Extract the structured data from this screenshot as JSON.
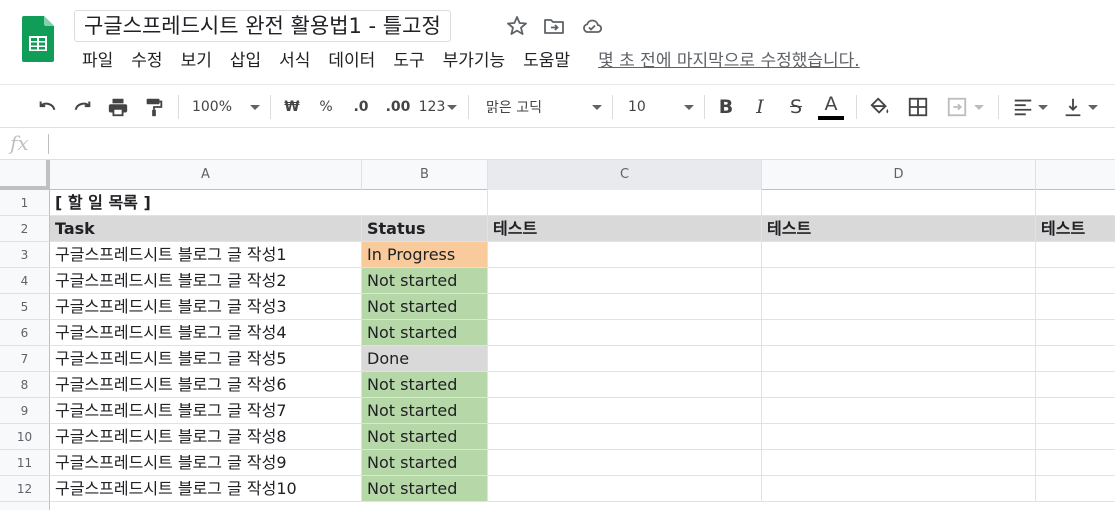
{
  "doc": {
    "title": "구글스프레드시트 완전 활용법1 - 틀고정"
  },
  "colors": {
    "sheets_green": "#0F9D58",
    "in_progress": "#f9cb9c",
    "not_started": "#b6d7a8",
    "done": "#d9d9d9",
    "header_fill": "#d9d9d9"
  },
  "menu": {
    "items": [
      "파일",
      "수정",
      "보기",
      "삽입",
      "서식",
      "데이터",
      "도구",
      "부가기능",
      "도움말"
    ],
    "last_edit": "몇 초 전에 마지막으로 수정했습니다."
  },
  "toolbar": {
    "zoom": "100%",
    "currency": "₩",
    "percent": "%",
    "dec_decrease": ".0",
    "dec_increase": ".00",
    "format_more": "123",
    "font": "맑은 고딕",
    "font_size": "10",
    "bold": "B",
    "italic": "I",
    "strike": "S",
    "text_color": "A"
  },
  "formula": {
    "fx": "fx",
    "value": ""
  },
  "columns": [
    "A",
    "B",
    "C",
    "D"
  ],
  "rows": [
    "1",
    "2",
    "3",
    "4",
    "5",
    "6",
    "7",
    "8",
    "9",
    "10",
    "11",
    "12"
  ],
  "sheet": {
    "r1": {
      "a": "[ 할 일 목록 ]"
    },
    "r2": {
      "a": "Task",
      "b": "Status",
      "c": "테스트",
      "d": "테스트",
      "e": "테스트"
    },
    "tasks": [
      {
        "task": "구글스프레드시트 블로그 글 작성1",
        "status": "In Progress"
      },
      {
        "task": "구글스프레드시트 블로그 글 작성2",
        "status": "Not started"
      },
      {
        "task": "구글스프레드시트 블로그 글 작성3",
        "status": "Not started"
      },
      {
        "task": "구글스프레드시트 블로그 글 작성4",
        "status": "Not started"
      },
      {
        "task": "구글스프레드시트 블로그 글 작성5",
        "status": "Done"
      },
      {
        "task": "구글스프레드시트 블로그 글 작성6",
        "status": "Not started"
      },
      {
        "task": "구글스프레드시트 블로그 글 작성7",
        "status": "Not started"
      },
      {
        "task": "구글스프레드시트 블로그 글 작성8",
        "status": "Not started"
      },
      {
        "task": "구글스프레드시트 블로그 글 작성9",
        "status": "Not started"
      },
      {
        "task": "구글스프레드시트 블로그 글 작성10",
        "status": "Not started"
      }
    ]
  }
}
